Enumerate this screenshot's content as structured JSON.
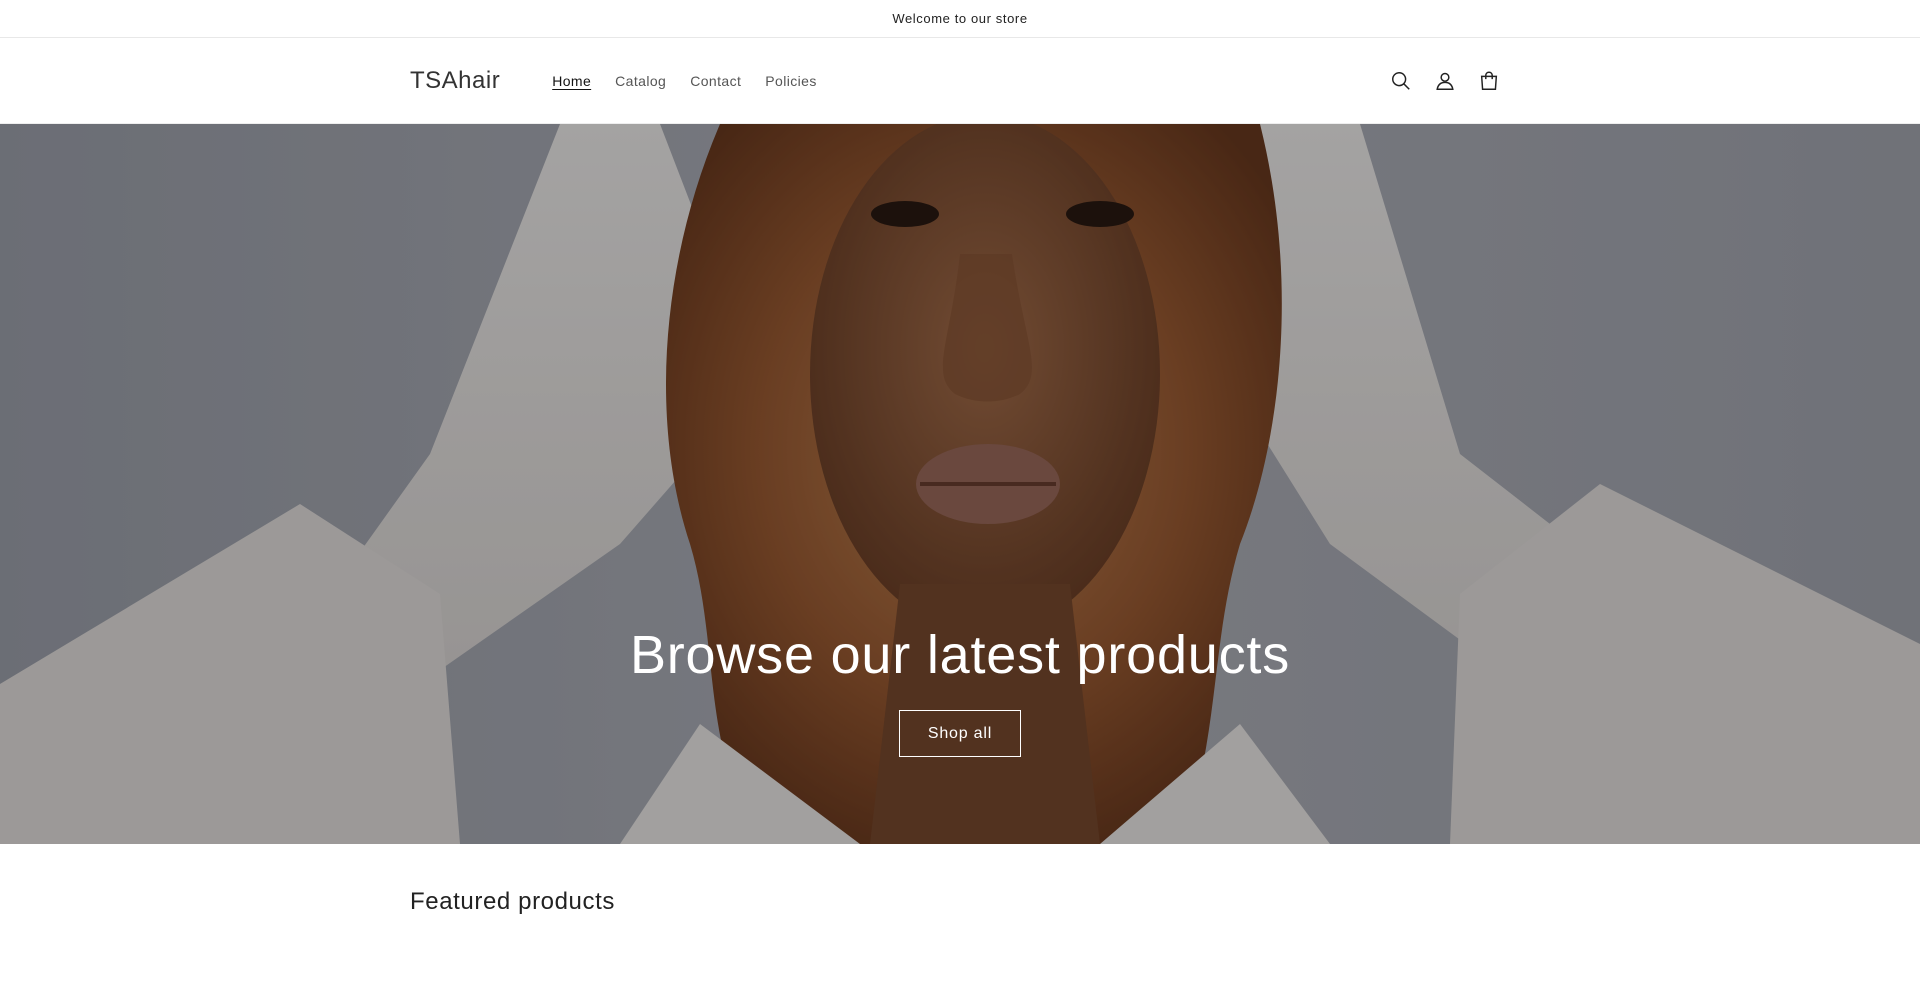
{
  "announcement": {
    "text": "Welcome to our store"
  },
  "header": {
    "logo": "TSAhair",
    "nav": [
      {
        "label": "Home",
        "active": true
      },
      {
        "label": "Catalog",
        "active": false
      },
      {
        "label": "Contact",
        "active": false
      },
      {
        "label": "Policies",
        "active": false
      }
    ],
    "icons": [
      "search-icon",
      "account-icon",
      "cart-icon"
    ]
  },
  "hero": {
    "title": "Browse our latest products",
    "button_label": "Shop all"
  },
  "featured": {
    "title": "Featured products"
  },
  "colors": {
    "text": "#121212",
    "hero_overlay": "#000000",
    "background": "#ffffff"
  }
}
